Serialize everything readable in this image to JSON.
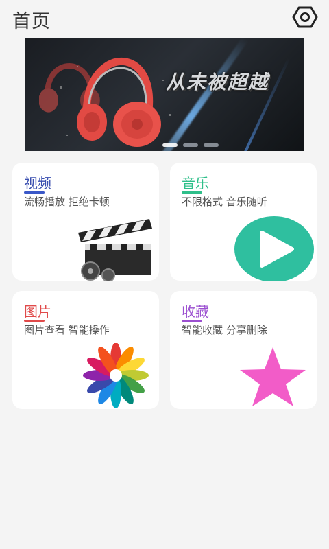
{
  "header": {
    "title": "首页",
    "settings_icon": "hexagon-settings-icon"
  },
  "banner": {
    "text": "从未被超越",
    "slide_count": 3,
    "active_slide": 1
  },
  "cards": [
    {
      "title": "视频",
      "subtitle": "流畅播放 拒绝卡顿",
      "title_color": "#3a4fb0",
      "underline_color": "#3a58c8",
      "icon": "film-clapperboard-icon"
    },
    {
      "title": "音乐",
      "subtitle": "不限格式 音乐随听",
      "title_color": "#2fbf8a",
      "underline_color": "#2fbf8a",
      "icon": "play-circle-icon"
    },
    {
      "title": "图片",
      "subtitle": "图片查看 智能操作",
      "title_color": "#e04a4a",
      "underline_color": "#e04a4a",
      "icon": "color-petals-icon"
    },
    {
      "title": "收藏",
      "subtitle": "智能收藏 分享删除",
      "title_color": "#9b4fd0",
      "underline_color": "#9b4fd0",
      "icon": "star-icon"
    }
  ]
}
